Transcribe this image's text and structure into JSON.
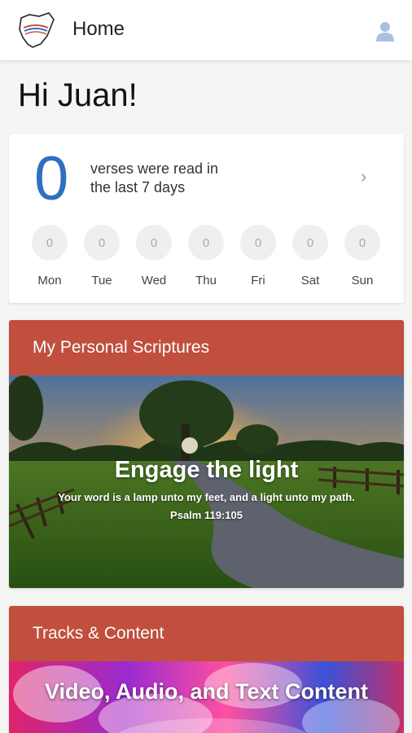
{
  "header": {
    "title": "Home",
    "logo_icon": "map-logo-icon",
    "avatar_icon": "user-icon"
  },
  "greeting": "Hi Juan!",
  "weekly": {
    "count": "0",
    "text_line1": "verses were read in",
    "text_line2": "the last 7 days",
    "days": [
      {
        "label": "Mon",
        "value": "0"
      },
      {
        "label": "Tue",
        "value": "0"
      },
      {
        "label": "Wed",
        "value": "0"
      },
      {
        "label": "Thu",
        "value": "0"
      },
      {
        "label": "Fri",
        "value": "0"
      },
      {
        "label": "Sat",
        "value": "0"
      },
      {
        "label": "Sun",
        "value": "0"
      }
    ]
  },
  "personal": {
    "header": "My Personal Scriptures",
    "hero_title": "Engage the light",
    "hero_verse": "Your word is a lamp unto my feet, and a light unto my path.",
    "hero_ref": "Psalm 119:105"
  },
  "tracks": {
    "header": "Tracks & Content",
    "banner_title": "Video, Audio, and Text Content"
  },
  "colors": {
    "accent_red": "#c04f3d",
    "count_blue": "#2f6fbf"
  }
}
